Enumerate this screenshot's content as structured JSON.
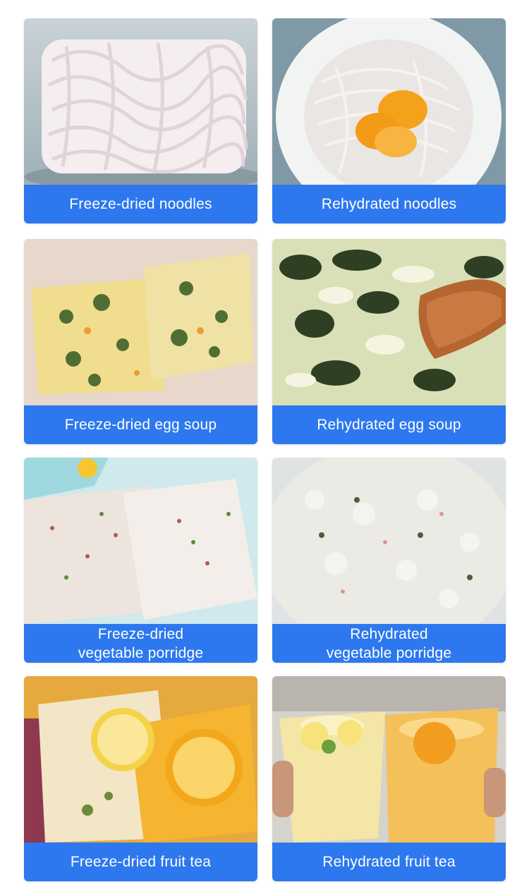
{
  "cards": [
    {
      "caption": "Freeze-dried noodles"
    },
    {
      "caption": "Rehydrated noodles"
    },
    {
      "caption": "Freeze-dried egg soup"
    },
    {
      "caption": "Rehydrated egg soup"
    },
    {
      "caption_line1": "Freeze-dried",
      "caption_line2": "vegetable porridge"
    },
    {
      "caption_line1": "Rehydrated",
      "caption_line2": "vegetable porridge"
    },
    {
      "caption": "Freeze-dried fruit tea"
    },
    {
      "caption": "Rehydrated fruit tea"
    }
  ],
  "colors": {
    "caption_bar": "#2d78ee",
    "caption_text": "#ffffff"
  }
}
